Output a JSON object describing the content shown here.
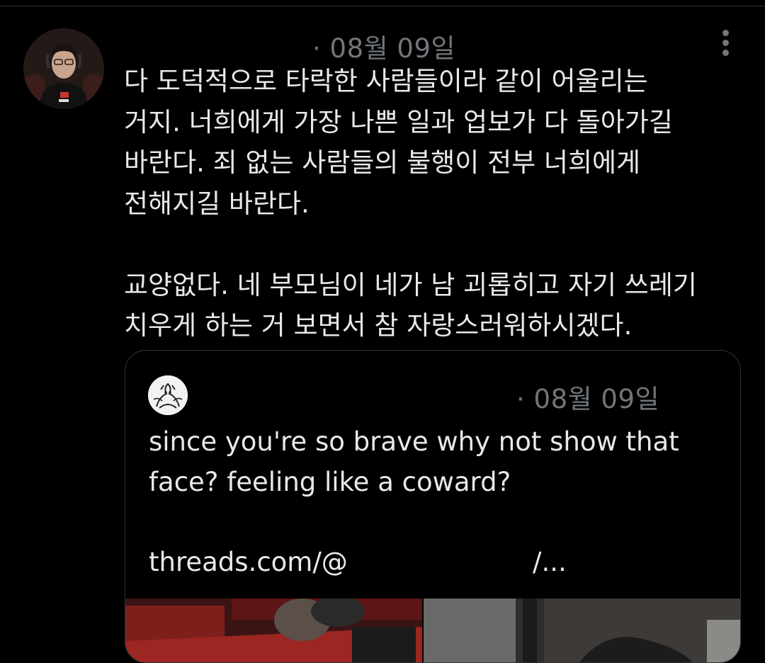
{
  "tweet": {
    "timestamp": "· 08월 09일",
    "text": "다 도덕적으로 타락한 사람들이라 같이 어울리는\n거지. 너희에게 가장 나쁜 일과 업보가 다 돌아가길\n바란다. 죄 없는 사람들의 불행이 전부 너희에게\n전해지길 바란다.\n\n교양없다. 네 부모님이 네가 남 괴롭히고 자기 쓰레기\n치우게 하는 거 보면서 참 자랑스러워하시겠다."
  },
  "quote": {
    "timestamp": "· 08월 09일",
    "text": "since you're so brave why not show that\nface? feeling like a coward?",
    "link_prefix": "threads.com/@",
    "link_suffix": "/..."
  },
  "icons": {
    "more": "more-vertical-icon",
    "avatar": "user-avatar",
    "quote_avatar": "quoted-user-avatar"
  },
  "colors": {
    "background": "#000000",
    "text": "#e7e9ea",
    "muted": "#71767b",
    "border": "#2f3336"
  }
}
